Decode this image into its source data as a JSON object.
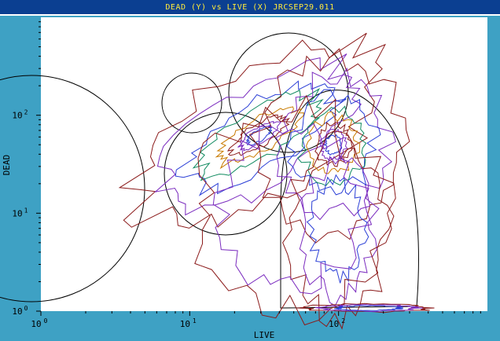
{
  "window": {
    "title": "DEAD (Y) vs LIVE (X) JRCSEP29.011"
  },
  "colors": {
    "title_bar": "#0b3f91",
    "title_text": "#ffeb3b",
    "frame": "#3ea1c4",
    "plot_background": "#ffffff"
  },
  "chart_data": {
    "type": "contour",
    "xlabel": "LIVE",
    "ylabel": "DEAD",
    "x_scale": "log",
    "y_scale": "log",
    "xlim": [
      1,
      1000
    ],
    "ylim": [
      1,
      1000
    ],
    "x_ticks": [
      {
        "value": 1,
        "base": "10",
        "exp": "0"
      },
      {
        "value": 10,
        "base": "10",
        "exp": "1"
      },
      {
        "value": 100,
        "base": "10",
        "exp": "2"
      }
    ],
    "y_ticks": [
      {
        "value": 1,
        "base": "10",
        "exp": "0"
      },
      {
        "value": 10,
        "base": "10",
        "exp": "1"
      },
      {
        "value": 100,
        "base": "10",
        "exp": "2"
      }
    ],
    "contour_colors": [
      "#8b1a1a",
      "#7b2cbf",
      "#2b3fd6",
      "#0f8a5f",
      "#c97b00"
    ],
    "regions": [
      {
        "id": "large-left",
        "shape": "circle"
      },
      {
        "id": "small-upper",
        "shape": "circle"
      },
      {
        "id": "upper-middle",
        "shape": "circle"
      },
      {
        "id": "middle-left",
        "shape": "circle"
      },
      {
        "id": "right-tall",
        "shape": "arch"
      }
    ]
  }
}
